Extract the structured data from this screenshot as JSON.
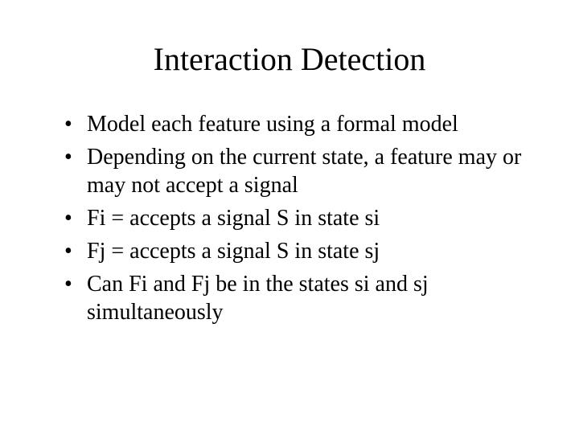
{
  "title": "Interaction Detection",
  "bullets": [
    "Model each feature using a formal model",
    "Depending on the current state, a feature may or may not accept a signal",
    "Fi = accepts a signal S in state si",
    "Fj = accepts a signal S in state sj",
    "Can Fi and Fj be in the states si and sj simultaneously"
  ]
}
